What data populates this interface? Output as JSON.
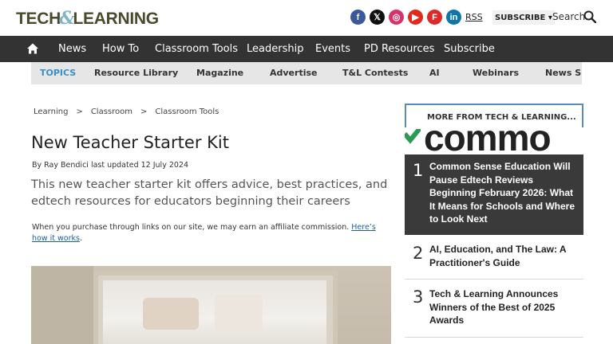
{
  "header": {
    "logo_left": "TECH",
    "logo_amp": "&",
    "logo_right": "LEARNING",
    "socials": [
      {
        "icon": "facebook-icon",
        "glyph": "f",
        "color": "#3b5998"
      },
      {
        "icon": "x-icon",
        "glyph": "𝕏",
        "color": "#111111"
      },
      {
        "icon": "instagram-icon",
        "glyph": "◎",
        "color": "#d6336c"
      },
      {
        "icon": "youtube-icon",
        "glyph": "▶",
        "color": "#e02a20"
      },
      {
        "icon": "flipboard-icon",
        "glyph": "F",
        "color": "#e12828"
      },
      {
        "icon": "linkedin-icon",
        "glyph": "in",
        "color": "#0e76a8"
      }
    ],
    "rss": "RSS",
    "subscribe": "SUBSCRIBE ▾",
    "search": "Search"
  },
  "nav": {
    "items": [
      "News",
      "How To",
      "Classroom Tools",
      "Leadership",
      "Events",
      "PD Resources",
      "Subscribe"
    ]
  },
  "topics": {
    "label": "TOPICS",
    "items": [
      "Resource Library",
      "Magazine",
      "Advertise",
      "T&L Contests",
      "AI",
      "Webinars",
      "News Sig"
    ]
  },
  "article": {
    "breadcrumbs": [
      "Learning",
      ">",
      "Classroom",
      ">",
      "Classroom Tools"
    ],
    "title": "New Teacher Starter Kit",
    "byline": "By Ray Bendici last updated 12 July 2024",
    "standfirst": "This new teacher starter kit offers advice, best practices, and edtech resources for educators beginning their careers",
    "affiliate_text": "When you purchase through links on our site, we may earn an affiliate commission. ",
    "affiliate_link": "Here’s how it works",
    "affiliate_end": "."
  },
  "sidebar": {
    "heading": "MORE FROM TECH & LEARNING...",
    "promo_word": "commo",
    "items": [
      {
        "num": "1",
        "text": "Common Sense Education Will Pause Edtech Reviews Beginning February 2026: What It Means for Schools and Where to Look Next"
      },
      {
        "num": "2",
        "text": "AI, Education, and The Law: A Practitioner's Guide"
      },
      {
        "num": "3",
        "text": "Tech & Learning Announces Winners of the Best of 2025 Awards"
      }
    ]
  }
}
